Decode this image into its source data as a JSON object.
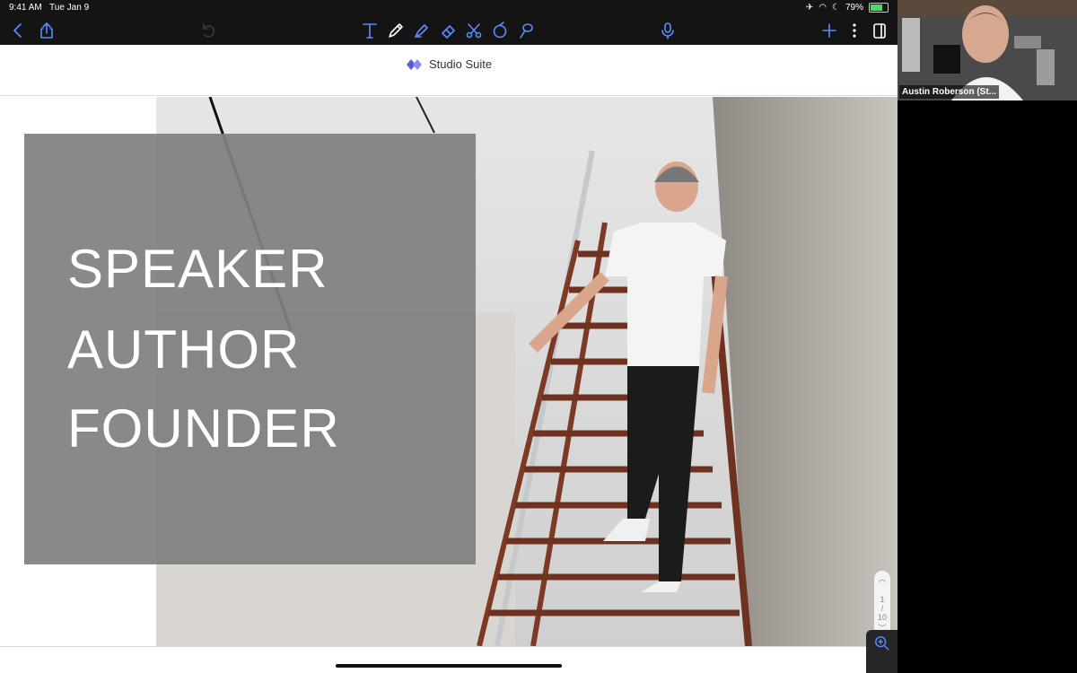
{
  "status_bar": {
    "time": "9:41 AM",
    "date": "Tue Jan 9",
    "battery": "79%",
    "battery_level": 0.79
  },
  "toolbar": {
    "icons": [
      "back-icon",
      "share-icon",
      "undo-icon",
      "text-tool-icon",
      "pen-icon",
      "highlighter-icon",
      "eraser-icon",
      "scissors-icon",
      "shapes-icon",
      "lasso-icon",
      "microphone-icon",
      "add-icon",
      "more-icon",
      "pages-icon"
    ]
  },
  "document": {
    "brand": "Studio Suite"
  },
  "slide": {
    "lines": [
      "SPEAKER",
      "AUTHOR",
      "FOUNDER"
    ]
  },
  "pager": {
    "current": "1",
    "separator": "/",
    "total": "10"
  },
  "video": {
    "participant_name": "Austin Roberson (St..."
  },
  "colors": {
    "accent": "#5b8cff",
    "overlay": "#808080",
    "brand": "#5b5bd6"
  }
}
